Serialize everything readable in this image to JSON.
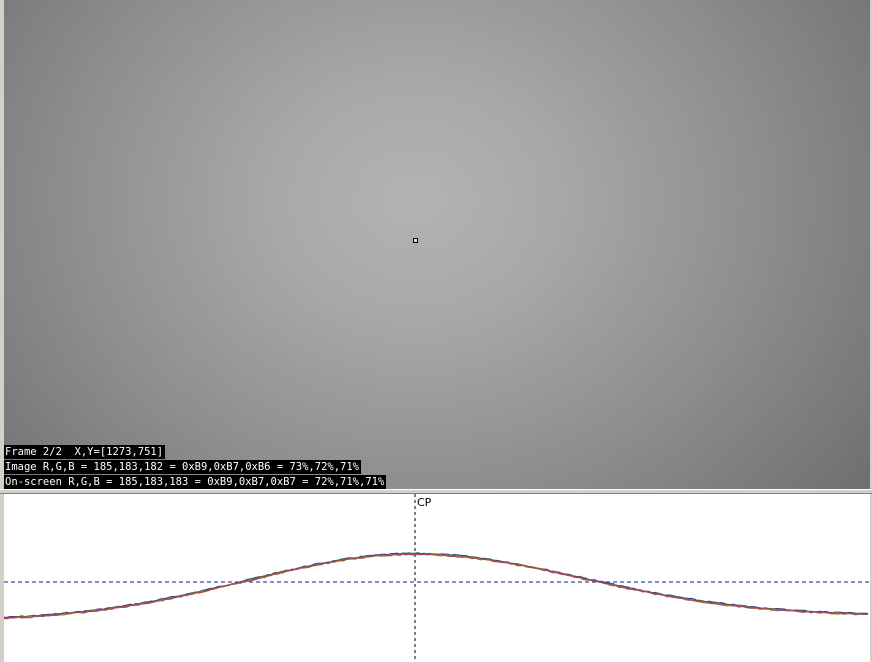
{
  "overlay": {
    "frame_line": "Frame 2/2  X,Y=[1273,751]",
    "image_line": "Image R,G,B = 185,183,182 = 0xB9,0xB7,0xB6 = 73%,72%,71%",
    "screen_line": "On-screen R,G,B = 185,183,183 = 0xB9,0xB7,0xB7 = 72%,71%,71%"
  },
  "profile": {
    "center_label": "CP",
    "colors": {
      "red": "#d43a3a",
      "green": "#2e8b2e",
      "blue": "#2a3fc8",
      "dash_h": "#1a1aa0",
      "dash_v": "#000000"
    },
    "icon": "crosshair-marker"
  }
}
